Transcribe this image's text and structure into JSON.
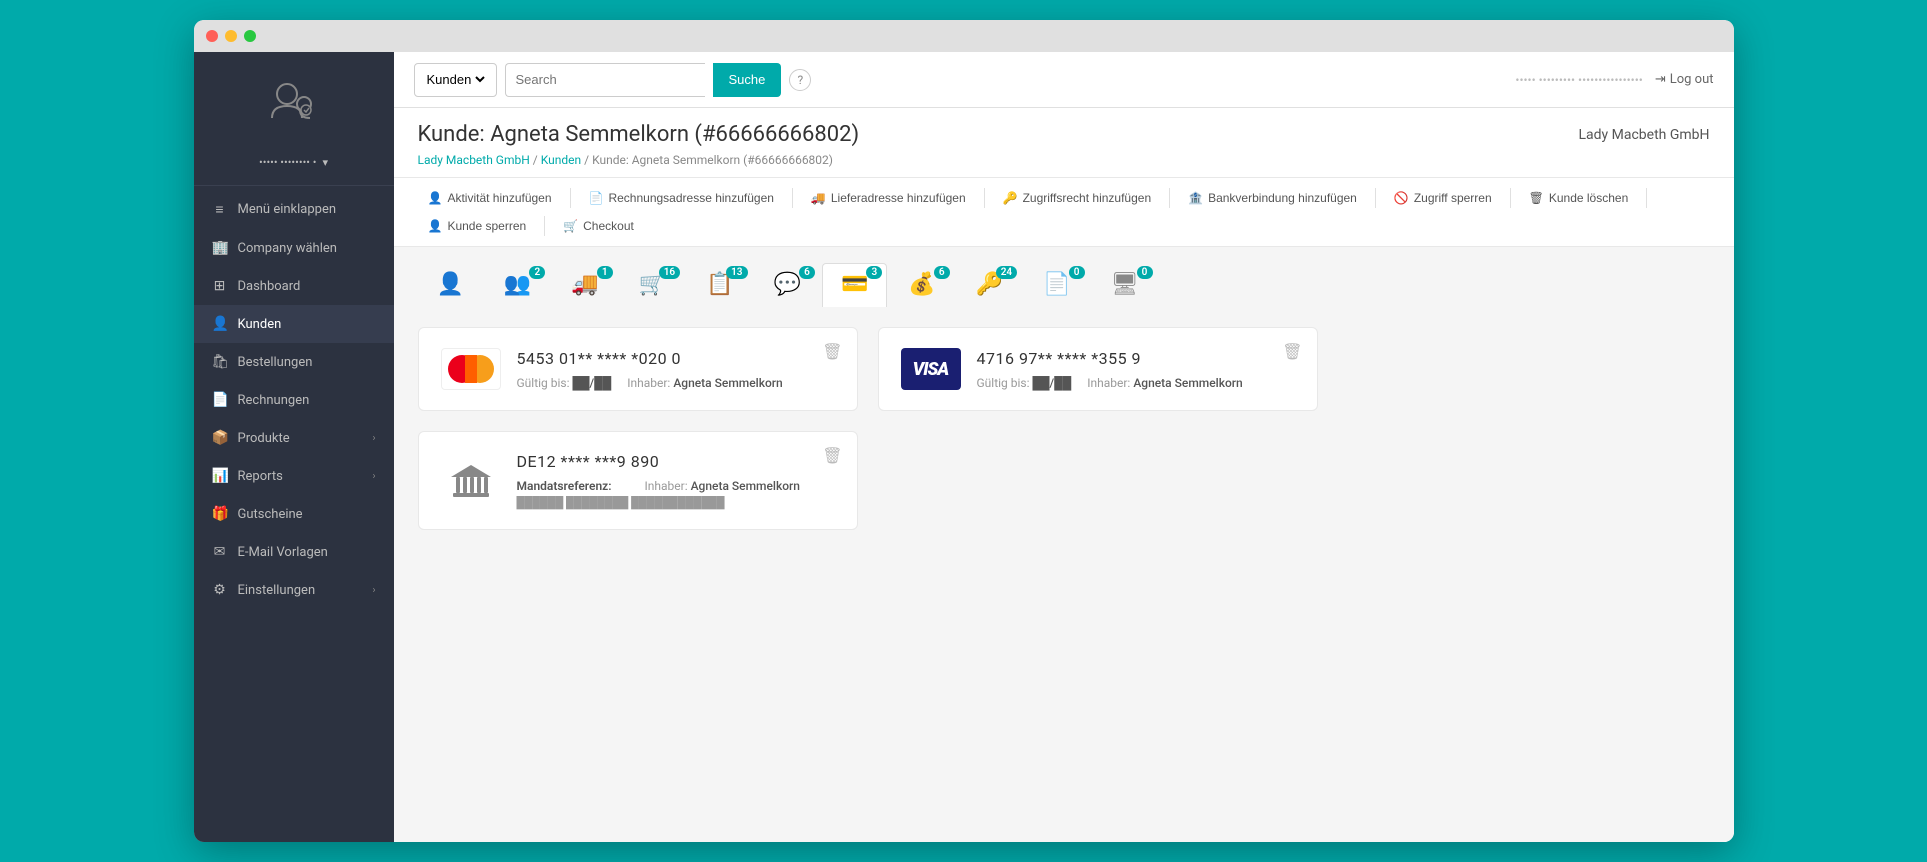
{
  "window": {
    "title": "Kunde: Agneta Semmelkorn"
  },
  "topbar": {
    "dropdown_value": "Kunden",
    "search_placeholder": "Search",
    "search_button": "Suche",
    "help_icon": "?",
    "user_info": "••••• ••••••••• ••••••••••••••••",
    "logout_label": "Log out"
  },
  "page": {
    "title": "Kunde: Agneta Semmelkorn (#66666666802)",
    "company": "Lady Macbeth GmbH",
    "breadcrumb_home": "Lady Macbeth GmbH",
    "breadcrumb_sep1": "/",
    "breadcrumb_kunden": "Kunden",
    "breadcrumb_sep2": "/",
    "breadcrumb_current": "Kunde: Agneta Semmelkorn (#66666666802)"
  },
  "actions": [
    {
      "id": "add-activity",
      "icon": "👤",
      "label": "Aktivität hinzufügen"
    },
    {
      "id": "add-invoice-address",
      "icon": "📄",
      "label": "Rechnungsadresse hinzufügen"
    },
    {
      "id": "add-delivery-address",
      "icon": "🚚",
      "label": "Lieferadresse hinzufügen"
    },
    {
      "id": "add-access",
      "icon": "🔑",
      "label": "Zugriffsrecht hinzufügen"
    },
    {
      "id": "add-bank",
      "icon": "🏦",
      "label": "Bankverbindung hinzufügen"
    },
    {
      "id": "block-access",
      "icon": "🚫",
      "label": "Zugriff sperren"
    },
    {
      "id": "delete-customer",
      "icon": "🗑",
      "label": "Kunde löschen"
    },
    {
      "id": "block-customer",
      "icon": "👤",
      "label": "Kunde sperren"
    },
    {
      "id": "checkout",
      "icon": "🛒",
      "label": "Checkout"
    }
  ],
  "tabs": [
    {
      "id": "profile",
      "icon": "👤",
      "badge": null,
      "active": false
    },
    {
      "id": "contacts",
      "icon": "👥",
      "badge": "2",
      "active": false
    },
    {
      "id": "delivery",
      "icon": "🚚",
      "badge": "1",
      "active": false
    },
    {
      "id": "orders",
      "icon": "🛒",
      "badge": "16",
      "active": false
    },
    {
      "id": "invoices",
      "icon": "📋",
      "badge": "13",
      "active": false
    },
    {
      "id": "messages",
      "icon": "💬",
      "badge": "6",
      "active": false
    },
    {
      "id": "payments",
      "icon": "💳",
      "badge": "3",
      "active": true
    },
    {
      "id": "credits",
      "icon": "💰",
      "badge": "6",
      "active": false
    },
    {
      "id": "keys",
      "icon": "🔑",
      "badge": "24",
      "active": false
    },
    {
      "id": "docs",
      "icon": "📄",
      "badge": "0",
      "active": false
    },
    {
      "id": "screens",
      "icon": "🖥",
      "badge": "0",
      "active": false
    }
  ],
  "payment_cards": [
    {
      "id": "mastercard",
      "type": "mastercard",
      "number": "5453 01** **** *020 0",
      "valid_label": "Gültig bis:",
      "valid_value": "██/██",
      "holder_label": "Inhaber:",
      "holder_value": "Agneta Semmelkorn"
    },
    {
      "id": "visa",
      "type": "visa",
      "number": "4716 97** **** *355 9",
      "valid_label": "Gültig bis:",
      "valid_value": "██/██",
      "holder_label": "Inhaber:",
      "holder_value": "Agneta Semmelkorn"
    },
    {
      "id": "iban",
      "type": "iban",
      "number": "DE12 **** ***9 890",
      "mandate_label": "Mandatsreferenz:",
      "mandate_value": "██████ ████████ ████████████",
      "holder_label": "Inhaber:",
      "holder_value": "Agneta Semmelkorn"
    }
  ],
  "sidebar": {
    "user_label": "••••• •••••••• •",
    "items": [
      {
        "id": "menu-collapse",
        "icon": "≡",
        "label": "Menü einklappen"
      },
      {
        "id": "company",
        "icon": "🏢",
        "label": "Company wählen"
      },
      {
        "id": "dashboard",
        "icon": "⊞",
        "label": "Dashboard"
      },
      {
        "id": "kunden",
        "icon": "👤",
        "label": "Kunden",
        "active": true
      },
      {
        "id": "bestellungen",
        "icon": "🛍",
        "label": "Bestellungen"
      },
      {
        "id": "rechnungen",
        "icon": "📄",
        "label": "Rechnungen"
      },
      {
        "id": "produkte",
        "icon": "📦",
        "label": "Produkte",
        "has_arrow": true
      },
      {
        "id": "reports",
        "icon": "📊",
        "label": "Reports",
        "has_arrow": true
      },
      {
        "id": "gutscheine",
        "icon": "🎁",
        "label": "Gutscheine"
      },
      {
        "id": "email-vorlagen",
        "icon": "✉",
        "label": "E-Mail Vorlagen"
      },
      {
        "id": "einstellungen",
        "icon": "⚙",
        "label": "Einstellungen",
        "has_arrow": true
      }
    ]
  }
}
